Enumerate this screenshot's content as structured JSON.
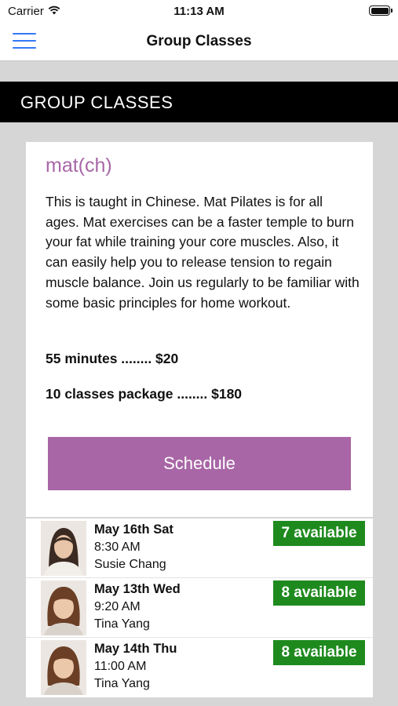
{
  "status_bar": {
    "carrier": "Carrier",
    "time": "11:13 AM"
  },
  "nav": {
    "title": "Group Classes",
    "menu_icon": "hamburger-menu-icon"
  },
  "section": {
    "title": "GROUP CLASSES"
  },
  "class": {
    "name": "mat(ch)",
    "description": "This is taught in Chinese. Mat Pilates is for all ages. Mat exercises can be a faster temple to burn your fat while training your core muscles. Also, it can easily help you to release tension to regain muscle balance. Join us regularly to be familiar with some basic principles for home workout.",
    "price_single": "55 minutes ........ $20",
    "price_package": "10 classes package ........ $180",
    "schedule_label": "Schedule"
  },
  "sessions": [
    {
      "date": "May 16th Sat",
      "time": "8:30 AM",
      "teacher": "Susie Chang",
      "availability": "7 available"
    },
    {
      "date": "May 13th Wed",
      "time": "9:20 AM",
      "teacher": "Tina Yang",
      "availability": "8 available"
    },
    {
      "date": "May 14th Thu",
      "time": "11:00 AM",
      "teacher": "Tina Yang",
      "availability": "8 available"
    }
  ],
  "colors": {
    "accent": "#a866a6",
    "available": "#1e8a1e",
    "nav_icon": "#3478f6",
    "header_bg": "#000000"
  }
}
